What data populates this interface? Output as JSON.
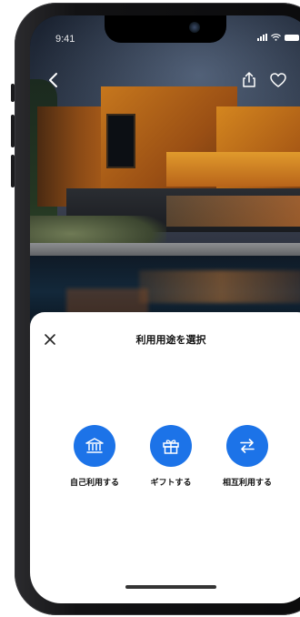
{
  "status_bar": {
    "time": "9:41"
  },
  "nav": {
    "back_icon": "chevron-left-icon",
    "share_icon": "share-icon",
    "favorite_icon": "heart-icon"
  },
  "sheet": {
    "title": "利用用途を選択",
    "close_icon": "close-icon",
    "options": [
      {
        "label": "自己利用する",
        "icon": "bank-icon"
      },
      {
        "label": "ギフトする",
        "icon": "gift-icon"
      },
      {
        "label": "相互利用する",
        "icon": "swap-arrows-icon"
      }
    ]
  },
  "colors": {
    "accent": "#1c73e8",
    "sheet_bg": "#ffffff",
    "text": "#111111"
  }
}
